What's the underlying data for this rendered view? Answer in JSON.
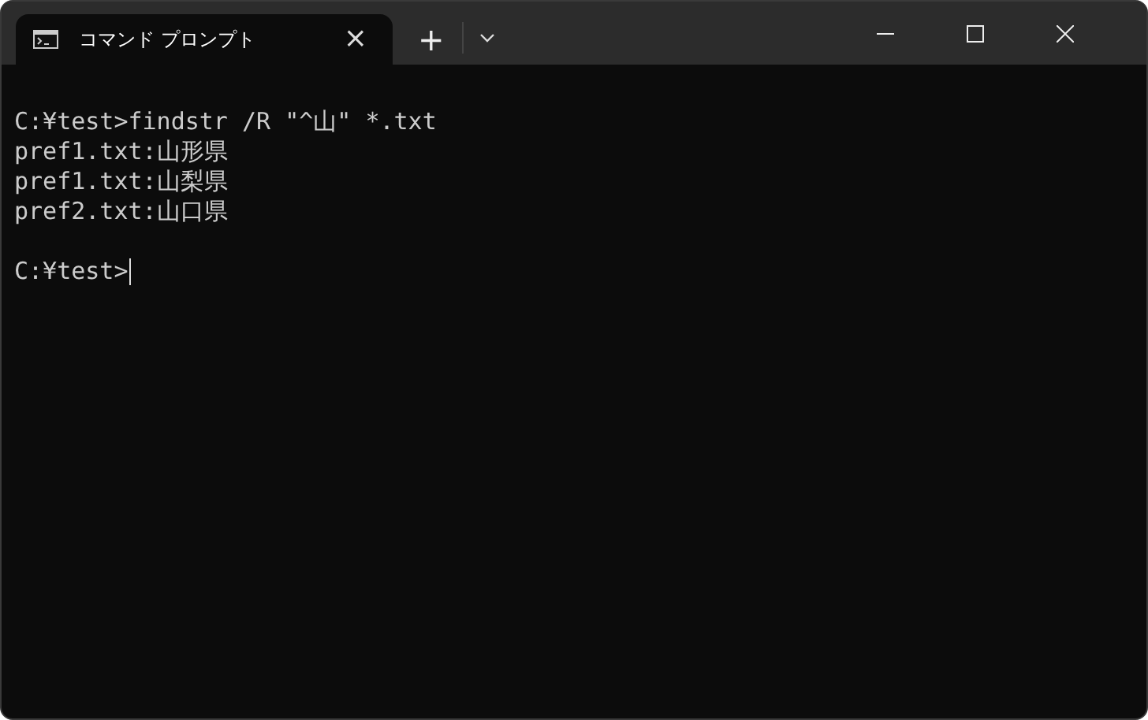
{
  "window": {
    "controls": [
      {
        "kind": "minimize"
      },
      {
        "kind": "maximize"
      },
      {
        "kind": "close"
      }
    ]
  },
  "tabs": [
    {
      "title": "コマンド プロンプト",
      "selected": true,
      "close": "×"
    }
  ],
  "new_tab": "+",
  "terminal": {
    "lines": [
      {
        "kind": "blank"
      },
      {
        "kind": "output",
        "text": "C:¥test>findstr /R \"^山\" *.txt"
      },
      {
        "kind": "output",
        "text": "pref1.txt:山形県"
      },
      {
        "kind": "output",
        "text": "pref1.txt:山梨県"
      },
      {
        "kind": "output",
        "text": "pref2.txt:山口県"
      },
      {
        "kind": "blank"
      },
      {
        "kind": "prompt",
        "text": "C:¥test>",
        "cursor": true
      }
    ]
  }
}
